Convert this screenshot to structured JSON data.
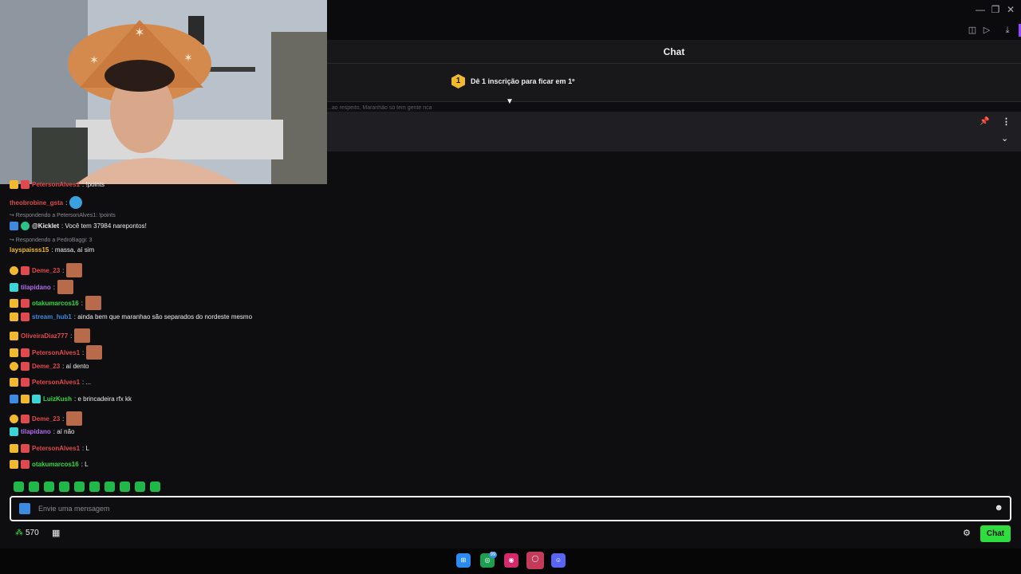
{
  "window": {
    "minimize": "—",
    "restore": "❐",
    "close": "✕",
    "tools": [
      "◫",
      "▷",
      "⤓"
    ]
  },
  "chat": {
    "header": "Chat",
    "leaderboard": {
      "rank": "1",
      "text": "Dê 1 inscrição para ficar em 1º"
    },
    "faded_preview": "...ao respeito, Maranhão só tem gente rica"
  },
  "messages": [
    {
      "badges": [
        "crown",
        "sub"
      ],
      "user": "PetersonAlves1",
      "user_color": "#e0494d",
      "text": ": !points"
    },
    {
      "badges": [],
      "user": "theobrobine_gsta",
      "user_color": "#e0494d",
      "text": ":",
      "emote": "blue"
    },
    {
      "reply": "Respondendo a PetersonAlves1: !points"
    },
    {
      "badges": [
        "prime",
        "green"
      ],
      "user": "@Kicklet",
      "user_color": "#efeff1",
      "text": ": Você tem 37984 narepontos!"
    },
    {
      "reply": "Respondendo a PedroBaggi: 3"
    },
    {
      "badges": [],
      "user": "layspaisss15",
      "user_color": "#f0b92e",
      "text": ": massa, aí sim"
    },
    {
      "badges": [
        "circle",
        "sub"
      ],
      "user": "Deme_23",
      "user_color": "#e0494d",
      "text": ":",
      "emote": "brown"
    },
    {
      "badges": [
        "gift"
      ],
      "user": "tilapidano",
      "user_color": "#b36cf0",
      "text": ":",
      "emote": "brown"
    },
    {
      "badges": [
        "crown",
        "sub"
      ],
      "user": "otakumarcos16",
      "user_color": "#2fdc3d",
      "text": ":",
      "emote": "brown"
    },
    {
      "badges": [
        "crown",
        "sub"
      ],
      "user": "stream_hub1",
      "user_color": "#3c8be0",
      "text": ": ainda bem que maranhao são separados do nordeste mesmo"
    },
    {
      "badges": [
        "crown"
      ],
      "user": "OliveiraDiaz777",
      "user_color": "#e0494d",
      "text": ":",
      "emote": "brown"
    },
    {
      "badges": [
        "crown",
        "sub"
      ],
      "user": "PetersonAlves1",
      "user_color": "#e0494d",
      "text": ":",
      "emote": "brown"
    },
    {
      "badges": [
        "circle",
        "sub"
      ],
      "user": "Deme_23",
      "user_color": "#e0494d",
      "text": ": aí dento"
    },
    {
      "badges": [
        "crown",
        "sub"
      ],
      "user": "PetersonAlves1",
      "user_color": "#e0494d",
      "text": ": ..."
    },
    {
      "badges": [
        "prime",
        "crown",
        "gift"
      ],
      "user": "LuizKush",
      "user_color": "#2fdc3d",
      "text": ": e brincadeira rfx kk"
    },
    {
      "badges": [
        "circle",
        "sub"
      ],
      "user": "Deme_23",
      "user_color": "#e0494d",
      "text": ":",
      "emote": "brown"
    },
    {
      "badges": [
        "gift"
      ],
      "user": "tilapidano",
      "user_color": "#b36cf0",
      "text": ": aí não"
    },
    {
      "badges": [
        "crown",
        "sub"
      ],
      "user": "PetersonAlves1",
      "user_color": "#e0494d",
      "text": ": L"
    },
    {
      "badges": [
        "crown",
        "sub"
      ],
      "user": "otakumarcos16",
      "user_color": "#2fdc3d",
      "text": ": L"
    }
  ],
  "input": {
    "placeholder": "Envie uma mensagem"
  },
  "footer": {
    "points": "570",
    "chat_button": "Chat"
  },
  "taskbar": {
    "whatsapp_badge": "99"
  }
}
